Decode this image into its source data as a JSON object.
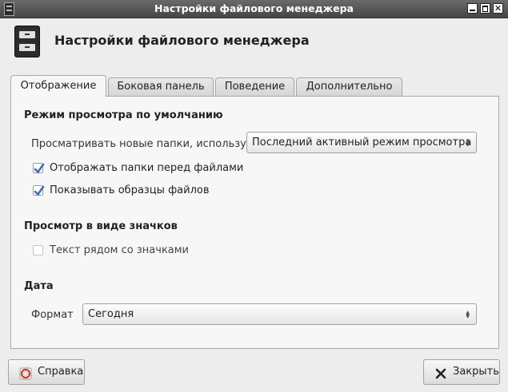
{
  "window": {
    "title": "Настройки файлового менеджера"
  },
  "header": {
    "title": "Настройки файлового менеджера",
    "icon": "file-cabinet-icon"
  },
  "tabs": [
    {
      "label": "Отображение",
      "active": true
    },
    {
      "label": "Боковая панель",
      "active": false
    },
    {
      "label": "Поведение",
      "active": false
    },
    {
      "label": "Дополнительно",
      "active": false
    }
  ],
  "default_view": {
    "title": "Режим просмотра по умолчанию",
    "view_new_folders_label": "Просматривать новые папки, используя:",
    "view_new_folders_value": "Последний активный режим просмотра",
    "show_folders_first": {
      "label": "Отображать папки перед файлами",
      "checked": true
    },
    "show_thumbnails": {
      "label": "Показывать образцы файлов",
      "checked": true
    }
  },
  "icon_view": {
    "title": "Просмотр в виде значков",
    "text_beside_icons": {
      "label": "Текст рядом со значками",
      "checked": false
    }
  },
  "date": {
    "title": "Дата",
    "format_label": "Формат",
    "format_value": "Сегодня"
  },
  "buttons": {
    "help": "Справка",
    "close": "Закрыть"
  },
  "colors": {
    "titlebar": "#454545",
    "check_accent": "#3f6fb5"
  }
}
